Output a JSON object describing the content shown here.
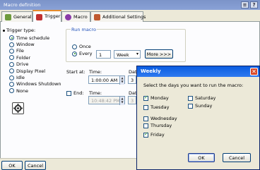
{
  "window": {
    "title": "Macro definition",
    "help_label": "?"
  },
  "tabs": [
    {
      "label": "General"
    },
    {
      "label": "Trigger"
    },
    {
      "label": "Macro"
    },
    {
      "label": "Additional Settings"
    }
  ],
  "trigger": {
    "type_label": "Trigger type:",
    "options": [
      {
        "label": "Time schedule",
        "selected": true
      },
      {
        "label": "Window",
        "selected": false
      },
      {
        "label": "File",
        "selected": false
      },
      {
        "label": "Folder",
        "selected": false
      },
      {
        "label": "Drive",
        "selected": false
      },
      {
        "label": "Display Pixel",
        "selected": false
      },
      {
        "label": "Idle",
        "selected": false
      },
      {
        "label": "Windows Shutdown",
        "selected": false
      },
      {
        "label": "None",
        "selected": false
      }
    ]
  },
  "run_macro": {
    "group_label": "Run macro",
    "once_label": "Once",
    "every_label": "Every",
    "every_value": "1",
    "period_value": "Week",
    "more_button": "More >>>"
  },
  "start": {
    "label": "Start at:",
    "time_label": "Time:",
    "time_value": "1:00:00 AM",
    "date_label": "Dat",
    "date_value": "3"
  },
  "end": {
    "label": "End:",
    "time_label": "Time:",
    "time_value": "10:48:42 PM",
    "date_label": "Dat",
    "date_value": "3"
  },
  "footer": {
    "ok_label": "OK",
    "cancel_label": "Cancel"
  },
  "weekly_dialog": {
    "title": "Weekly",
    "prompt": "Select the days you want to run the macro:",
    "days": [
      {
        "label": "Monday",
        "checked": true
      },
      {
        "label": "Tuesday",
        "checked": false
      },
      {
        "label": "Wednesday",
        "checked": false
      },
      {
        "label": "Thursday",
        "checked": false
      },
      {
        "label": "Friday",
        "checked": true
      },
      {
        "label": "Saturday",
        "checked": false
      },
      {
        "label": "Sunday",
        "checked": false
      }
    ],
    "ok_label": "OK",
    "cancel_label": "Cancel"
  }
}
